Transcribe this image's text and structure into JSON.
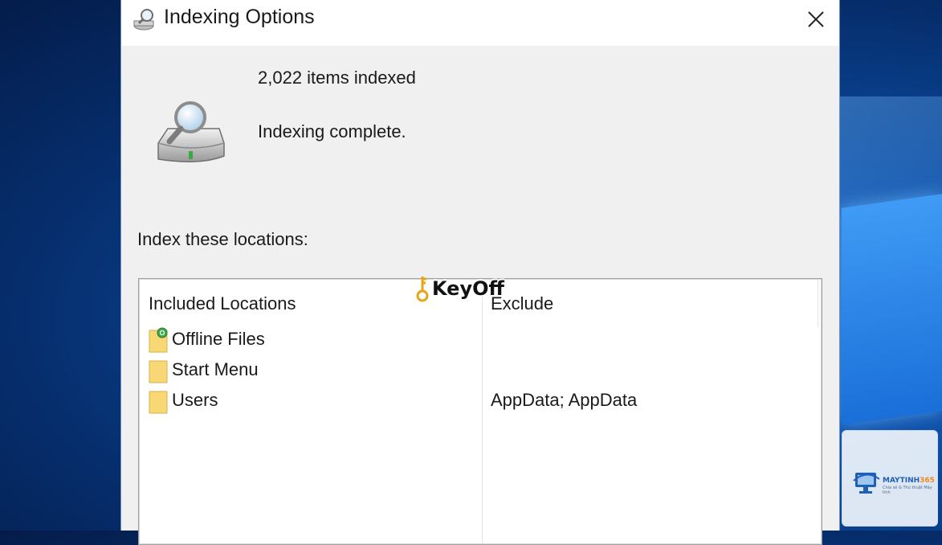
{
  "window": {
    "title": "Indexing Options",
    "title_icon": "indexing-options-icon",
    "close_icon": "close-icon"
  },
  "summary": {
    "icon": "drive-magnifier-icon",
    "items_indexed": "2,022 items indexed",
    "status": "Indexing complete."
  },
  "locations": {
    "label": "Index these locations:",
    "columns": {
      "included": "Included Locations",
      "exclude": "Exclude"
    },
    "rows": [
      {
        "name": "Offline Files",
        "exclude": "",
        "icon": "offline-files-folder-icon"
      },
      {
        "name": "Start Menu",
        "exclude": "",
        "icon": "folder-icon"
      },
      {
        "name": "Users",
        "exclude": "AppData; AppData",
        "icon": "folder-icon"
      }
    ]
  },
  "watermarks": {
    "keyoff": "KeyOff",
    "brand_main": "MAYTINH",
    "brand_accent": "365",
    "brand_tagline": "Chia sẻ & Thủ thuật Máy tính"
  },
  "colors": {
    "desktop": "#0b4a9e",
    "window_bg": "#f0f0f0",
    "folder": "#f8d775",
    "offline_badge": "#3aa845"
  }
}
